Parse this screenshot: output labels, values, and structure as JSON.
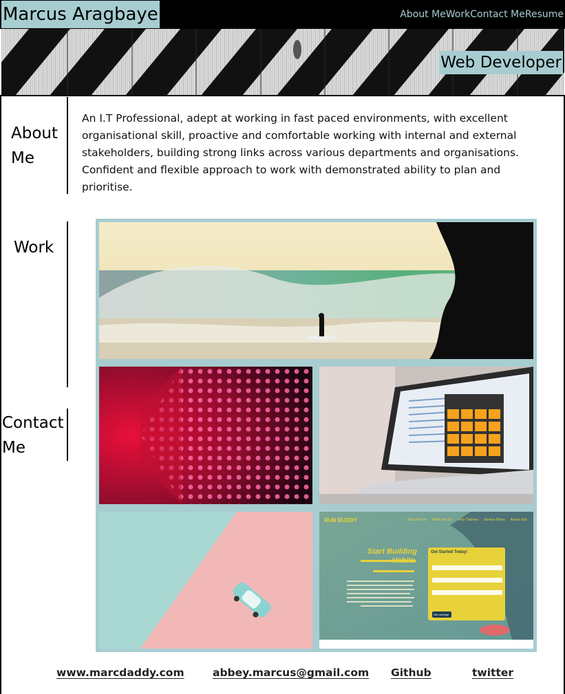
{
  "header": {
    "brand": "Marcus Aragbaye",
    "nav": [
      {
        "label": "About Me"
      },
      {
        "label": "Work"
      },
      {
        "label": "Contact Me"
      },
      {
        "label": "Resume"
      }
    ]
  },
  "hero": {
    "title": "Web Developer"
  },
  "about": {
    "heading": "About Me",
    "text": "An I.T Professional, adept at working in fast paced environments, with excellent organisational skill, proactive and comfortable working with internal and external stakeholders, building strong links across various departments and organisations. Confident and flexible approach to work with demonstrated ability to plan and prioritise."
  },
  "work": {
    "heading": "Work",
    "tiles": [
      {
        "icon": "surf-photo"
      },
      {
        "icon": "led-wall-photo"
      },
      {
        "icon": "calculator-laptop-photo"
      },
      {
        "icon": "toy-car-photo"
      },
      {
        "icon": "run-buddy-screenshot"
      }
    ],
    "run_buddy": {
      "logo": "RUN BUDDY",
      "nav": [
        "What We Do",
        "What You Do",
        "Your Trainers",
        "Service Plans",
        "Reach Out"
      ],
      "headline": "Start Building Habits.",
      "form_title": "Get Started Today!",
      "button": "Get running!"
    }
  },
  "contact": {
    "heading": "Contact Me"
  },
  "footer": {
    "links": [
      {
        "label": "www.marcdaddy.com"
      },
      {
        "label": "abbey.marcus@gmail.com"
      },
      {
        "label": "Github"
      },
      {
        "label": "twitter"
      }
    ]
  },
  "colors": {
    "accent": "#a7cdd1",
    "header_bg": "#000000"
  }
}
